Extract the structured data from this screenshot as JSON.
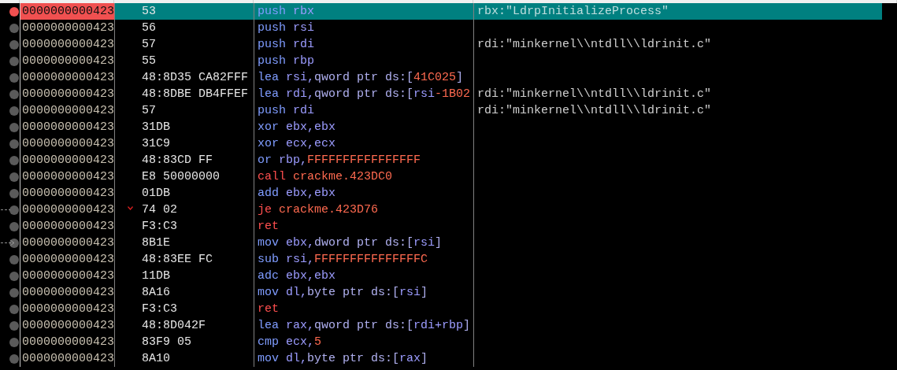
{
  "rows": [
    {
      "address": "0000000000423",
      "bytes": "53",
      "instruction": [
        {
          "text": "push ",
          "kind": "op"
        },
        {
          "text": "rbx",
          "kind": "reg"
        }
      ],
      "comment": "rbx:\"LdrpInitializeProcess\"",
      "selected": true,
      "breakpoint": true,
      "jump_source": false,
      "jump_target": false,
      "branch_arrow": false
    },
    {
      "address": "0000000000423",
      "bytes": "56",
      "instruction": [
        {
          "text": "push ",
          "kind": "op"
        },
        {
          "text": "rsi",
          "kind": "reg"
        }
      ],
      "selected": false,
      "breakpoint": false,
      "jump_source": false,
      "jump_target": false,
      "branch_arrow": false
    },
    {
      "address": "0000000000423",
      "bytes": "57",
      "instruction": [
        {
          "text": "push ",
          "kind": "op"
        },
        {
          "text": "rdi",
          "kind": "reg"
        }
      ],
      "comment": "rdi:\"minkernel\\\\ntdll\\\\ldrinit.c\"",
      "selected": false,
      "breakpoint": false,
      "jump_source": false,
      "jump_target": false,
      "branch_arrow": false
    },
    {
      "address": "0000000000423",
      "bytes": "55",
      "instruction": [
        {
          "text": "push ",
          "kind": "op"
        },
        {
          "text": "rbp",
          "kind": "reg"
        }
      ],
      "selected": false,
      "breakpoint": false,
      "jump_source": false,
      "jump_target": false,
      "branch_arrow": false
    },
    {
      "address": "0000000000423",
      "bytes": "48:8D35 CA82FFF",
      "instruction": [
        {
          "text": "lea ",
          "kind": "op"
        },
        {
          "text": "rsi,",
          "kind": "reg"
        },
        {
          "text": "qword ptr ds:[",
          "kind": "mem"
        },
        {
          "text": "41C025",
          "kind": "num"
        },
        {
          "text": "]",
          "kind": "mem"
        }
      ],
      "selected": false,
      "breakpoint": false,
      "jump_source": false,
      "jump_target": false,
      "branch_arrow": false
    },
    {
      "address": "0000000000423",
      "bytes": "48:8DBE DB4FFEF",
      "instruction": [
        {
          "text": "lea ",
          "kind": "op"
        },
        {
          "text": "rdi,",
          "kind": "reg"
        },
        {
          "text": "qword ptr ds:[",
          "kind": "mem"
        },
        {
          "text": "rsi",
          "kind": "reg"
        },
        {
          "text": "-1B02",
          "kind": "num"
        }
      ],
      "comment": "rdi:\"minkernel\\\\ntdll\\\\ldrinit.c\"",
      "selected": false,
      "breakpoint": false,
      "jump_source": false,
      "jump_target": false,
      "branch_arrow": false
    },
    {
      "address": "0000000000423",
      "bytes": "57",
      "instruction": [
        {
          "text": "push ",
          "kind": "op"
        },
        {
          "text": "rdi",
          "kind": "reg"
        }
      ],
      "comment": "rdi:\"minkernel\\\\ntdll\\\\ldrinit.c\"",
      "selected": false,
      "breakpoint": false,
      "jump_source": false,
      "jump_target": false,
      "branch_arrow": false
    },
    {
      "address": "0000000000423",
      "bytes": "31DB",
      "instruction": [
        {
          "text": "xor ",
          "kind": "op"
        },
        {
          "text": "ebx,ebx",
          "kind": "reg"
        }
      ],
      "selected": false,
      "breakpoint": false,
      "jump_source": false,
      "jump_target": false,
      "branch_arrow": false
    },
    {
      "address": "0000000000423",
      "bytes": "31C9",
      "instruction": [
        {
          "text": "xor ",
          "kind": "op"
        },
        {
          "text": "ecx,ecx",
          "kind": "reg"
        }
      ],
      "selected": false,
      "breakpoint": false,
      "jump_source": false,
      "jump_target": false,
      "branch_arrow": false
    },
    {
      "address": "0000000000423",
      "bytes": "48:83CD FF",
      "instruction": [
        {
          "text": "or ",
          "kind": "op"
        },
        {
          "text": "rbp,",
          "kind": "reg"
        },
        {
          "text": "FFFFFFFFFFFFFFFF",
          "kind": "num"
        }
      ],
      "selected": false,
      "breakpoint": false,
      "jump_source": false,
      "jump_target": false,
      "branch_arrow": false
    },
    {
      "address": "0000000000423",
      "bytes": "E8 50000000",
      "instruction": [
        {
          "text": "call ",
          "kind": "jump"
        },
        {
          "text": "crackme.423DC0",
          "kind": "num"
        }
      ],
      "selected": false,
      "breakpoint": false,
      "jump_source": false,
      "jump_target": false,
      "branch_arrow": false
    },
    {
      "address": "0000000000423",
      "bytes": "01DB",
      "instruction": [
        {
          "text": "add ",
          "kind": "op"
        },
        {
          "text": "ebx,ebx",
          "kind": "reg"
        }
      ],
      "selected": false,
      "breakpoint": false,
      "jump_source": false,
      "jump_target": false,
      "branch_arrow": false
    },
    {
      "address": "0000000000423",
      "bytes": "74 02",
      "instruction": [
        {
          "text": "je ",
          "kind": "jump"
        },
        {
          "text": "crackme.423D76",
          "kind": "num"
        }
      ],
      "selected": false,
      "breakpoint": false,
      "jump_source": true,
      "jump_target": false,
      "branch_arrow": true
    },
    {
      "address": "0000000000423",
      "bytes": "F3:C3",
      "instruction": [
        {
          "text": "ret",
          "kind": "jump"
        }
      ],
      "selected": false,
      "breakpoint": false,
      "jump_source": false,
      "jump_target": false,
      "branch_arrow": false
    },
    {
      "address": "0000000000423",
      "bytes": "8B1E",
      "instruction": [
        {
          "text": "mov ",
          "kind": "op"
        },
        {
          "text": "ebx,",
          "kind": "reg"
        },
        {
          "text": "dword ptr ds:[",
          "kind": "mem"
        },
        {
          "text": "rsi",
          "kind": "reg"
        },
        {
          "text": "]",
          "kind": "mem"
        }
      ],
      "selected": false,
      "breakpoint": false,
      "jump_source": false,
      "jump_target": true,
      "branch_arrow": false
    },
    {
      "address": "0000000000423",
      "bytes": "48:83EE FC",
      "instruction": [
        {
          "text": "sub ",
          "kind": "op"
        },
        {
          "text": "rsi,",
          "kind": "reg"
        },
        {
          "text": "FFFFFFFFFFFFFFFC",
          "kind": "num"
        }
      ],
      "selected": false,
      "breakpoint": false,
      "jump_source": false,
      "jump_target": false,
      "branch_arrow": false
    },
    {
      "address": "0000000000423",
      "bytes": "11DB",
      "instruction": [
        {
          "text": "adc ",
          "kind": "op"
        },
        {
          "text": "ebx,ebx",
          "kind": "reg"
        }
      ],
      "selected": false,
      "breakpoint": false,
      "jump_source": false,
      "jump_target": false,
      "branch_arrow": false
    },
    {
      "address": "0000000000423",
      "bytes": "8A16",
      "instruction": [
        {
          "text": "mov ",
          "kind": "op"
        },
        {
          "text": "dl,",
          "kind": "reg"
        },
        {
          "text": "byte ptr ds:[",
          "kind": "mem"
        },
        {
          "text": "rsi",
          "kind": "reg"
        },
        {
          "text": "]",
          "kind": "mem"
        }
      ],
      "selected": false,
      "breakpoint": false,
      "jump_source": false,
      "jump_target": false,
      "branch_arrow": false
    },
    {
      "address": "0000000000423",
      "bytes": "F3:C3",
      "instruction": [
        {
          "text": "ret",
          "kind": "jump"
        }
      ],
      "selected": false,
      "breakpoint": false,
      "jump_source": false,
      "jump_target": false,
      "branch_arrow": false
    },
    {
      "address": "0000000000423",
      "bytes": "48:8D042F",
      "instruction": [
        {
          "text": "lea ",
          "kind": "op"
        },
        {
          "text": "rax,",
          "kind": "reg"
        },
        {
          "text": "qword ptr ds:[",
          "kind": "mem"
        },
        {
          "text": "rdi+rbp",
          "kind": "reg"
        },
        {
          "text": "]",
          "kind": "mem"
        }
      ],
      "selected": false,
      "breakpoint": false,
      "jump_source": false,
      "jump_target": false,
      "branch_arrow": false
    },
    {
      "address": "0000000000423",
      "bytes": "83F9 05",
      "instruction": [
        {
          "text": "cmp ",
          "kind": "op"
        },
        {
          "text": "ecx,",
          "kind": "reg"
        },
        {
          "text": "5",
          "kind": "num"
        }
      ],
      "selected": false,
      "breakpoint": false,
      "jump_source": false,
      "jump_target": false,
      "branch_arrow": false
    },
    {
      "address": "0000000000423",
      "bytes": "8A10",
      "instruction": [
        {
          "text": "mov ",
          "kind": "op"
        },
        {
          "text": "dl,",
          "kind": "reg"
        },
        {
          "text": "byte ptr ds:[",
          "kind": "mem"
        },
        {
          "text": "rax",
          "kind": "reg"
        },
        {
          "text": "]",
          "kind": "mem"
        }
      ],
      "selected": false,
      "breakpoint": false,
      "jump_source": false,
      "jump_target": false,
      "branch_arrow": false
    }
  ]
}
